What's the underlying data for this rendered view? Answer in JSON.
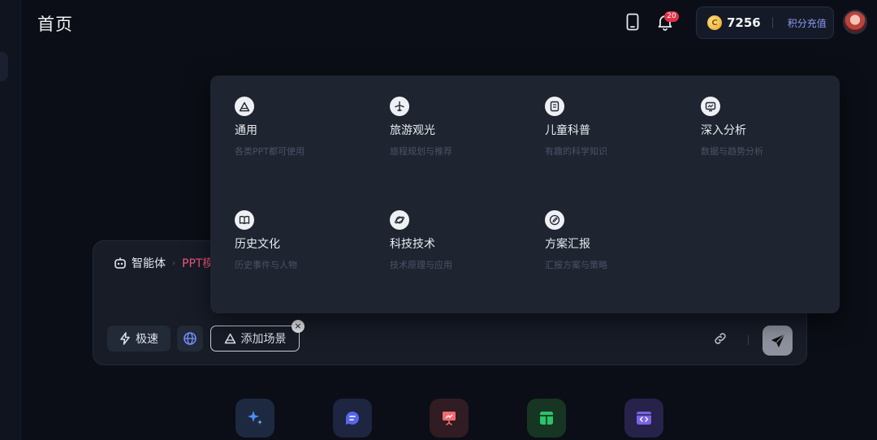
{
  "header": {
    "title": "首页",
    "notification_count": "20",
    "points": "7256",
    "coin_symbol": "C",
    "recharge_label": "积分充值"
  },
  "composer": {
    "agent_label": "智能体",
    "crumb_sep": "›",
    "agent_mode": "PPT模",
    "fast_label": "极速",
    "scene_label": "添加场景",
    "close_symbol": "×"
  },
  "scene_menu": {
    "items": [
      {
        "name": "通用",
        "desc": "各类PPT都可使用",
        "icon": "triangle-icon"
      },
      {
        "name": "旅游观光",
        "desc": "旅程规划与推荐",
        "icon": "plane-icon"
      },
      {
        "name": "儿童科普",
        "desc": "有趣的科学知识",
        "icon": "book-kid-icon"
      },
      {
        "name": "深入分析",
        "desc": "数据与趋势分析",
        "icon": "monitor-chart-icon"
      },
      {
        "name": "历史文化",
        "desc": "历史事件与人物",
        "icon": "open-book-icon"
      },
      {
        "name": "科技技术",
        "desc": "技术原理与应用",
        "icon": "planet-icon"
      },
      {
        "name": "方案汇报",
        "desc": "汇报方案与策略",
        "icon": "edit-icon"
      }
    ]
  },
  "dock": {
    "items": [
      {
        "icon": "sparkle-icon",
        "color": "#1d2940"
      },
      {
        "icon": "chat-bubble-icon",
        "color": "#1d2540"
      },
      {
        "icon": "presentation-icon",
        "color": "#301c22"
      },
      {
        "icon": "table-icon",
        "color": "#163522"
      },
      {
        "icon": "code-window-icon",
        "color": "#27224a"
      }
    ]
  }
}
